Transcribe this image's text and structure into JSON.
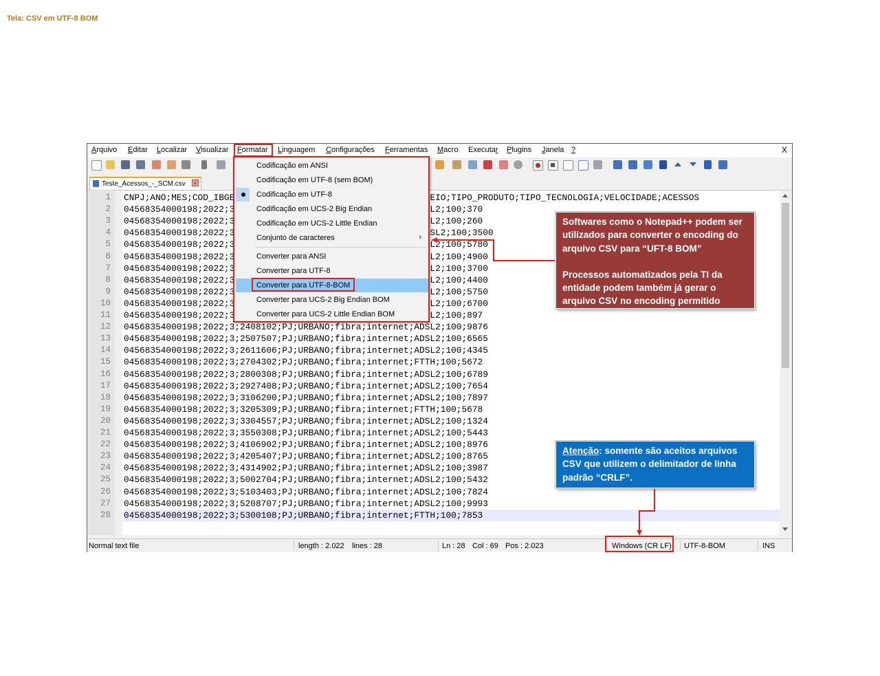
{
  "page": {
    "caption": "Tela: CSV em UTF-8 BOM"
  },
  "menubar": {
    "items": [
      {
        "id": "arquivo",
        "pre": "",
        "u": "A",
        "post": "rquivo"
      },
      {
        "id": "editar",
        "pre": "",
        "u": "E",
        "post": "ditar"
      },
      {
        "id": "localizar",
        "pre": "",
        "u": "L",
        "post": "ocalizar"
      },
      {
        "id": "visualizar",
        "pre": "",
        "u": "V",
        "post": "isualizar"
      },
      {
        "id": "formatar",
        "pre": "",
        "u": "F",
        "post": "ormatar"
      },
      {
        "id": "linguagem",
        "pre": "",
        "u": "L",
        "post": "inguagem"
      },
      {
        "id": "configuracoes",
        "pre": "",
        "u": "C",
        "post": "onfigurações"
      },
      {
        "id": "ferramentas",
        "pre": "",
        "u": "F",
        "post": "erramentas"
      },
      {
        "id": "macro",
        "pre": "",
        "u": "M",
        "post": "acro"
      },
      {
        "id": "executar",
        "pre": "Executa",
        "u": "r",
        "post": ""
      },
      {
        "id": "plugins",
        "pre": "",
        "u": "P",
        "post": "lugins"
      },
      {
        "id": "janela",
        "pre": "",
        "u": "J",
        "post": "anela"
      },
      {
        "id": "help",
        "pre": "",
        "u": "?",
        "post": ""
      }
    ],
    "close": "X"
  },
  "tab": {
    "label": "Teste_Acessos_-_SCM.csv",
    "close": "×"
  },
  "format_menu": {
    "items": [
      {
        "label": "Codificação em ANSI"
      },
      {
        "label": "Codificação em UTF-8 (sem BOM)"
      },
      {
        "label": "Codificação em UTF-8",
        "checked": true
      },
      {
        "label": "Codificação em UCS-2 Big Endian"
      },
      {
        "label": "Codificação em UCS-2 Little Endian"
      },
      {
        "label": "Conjunto de caracteres",
        "submenu_arrow": "›"
      },
      {
        "label": "Converter para ANSI"
      },
      {
        "label": "Converter para UTF-8"
      },
      {
        "label": "Converter para UTF-8-BOM",
        "highlighted": true
      },
      {
        "label": "Converter para UCS-2 Big Endian BOM"
      },
      {
        "label": "Converter para UCS-2 Little Endian BOM"
      }
    ]
  },
  "editor": {
    "line_numbers": [
      "1",
      "2",
      "3",
      "4",
      "5",
      "6",
      "7",
      "8",
      "9",
      "10",
      "11",
      "12",
      "13",
      "14",
      "15",
      "16",
      "17",
      "18",
      "19",
      "20",
      "21",
      "22",
      "23",
      "24",
      "25",
      "26",
      "27",
      "28"
    ],
    "lines": [
      "CNPJ;ANO;MES;COD_IBGE;TIPO_CLIENTE;TIPO_ATENDIMENTO;TIPO_MEIO;TIPO_PRODUTO;TIPO_TECNOLOGIA;VELOCIDADE;ACESSOS",
      "04568354000198;2022;3;1100015;PJ;URBANO;fibra;internet;ADSL2;100;370",
      "04568354000198;2022;3;1200401;PJ;URBANO;fibra;internet;ADSL2;100;260",
      "04568354000198;2022;3;1302603;PJ;URBANO;fibra;internet;ADSSL2;100;3500",
      "04568354000198;2022;3;1400100;PJ;URBANO;fibra;internet;ADSL2;100;5780",
      "04568354000198;2022;3;1501402;PJ;URBANO;fibra;internet;ADSL2;100;4900",
      "04568354000198;2022;3;1600303;PJ;URBANO;fibra;internet;ADSL2;100;3700",
      "04568354000198;2022;3;1721000;PJ;URBANO;fibra;internet;ADSL2;100;4400",
      "04568354000198;2022;3;2111300;PJ;URBANO;fibra;internet;ADSL2;100;5750",
      "04568354000198;2022;3;2211001;PJ;URBANO;fibra;internet;ADSL2;100;6700",
      "04568354000198;2022;3;2304400;PJ;URBANO;fibra;internet;ADSL2;100;897",
      "04568354000198;2022;3;2408102;PJ;URBANO;fibra;internet;ADSL2;100;9876",
      "04568354000198;2022;3;2507507;PJ;URBANO;fibra;internet;ADSL2;100;6565",
      "04568354000198;2022;3;2611606;PJ;URBANO;fibra;internet;ADSL2;100;4345",
      "04568354000198;2022;3;2704302;PJ;URBANO;fibra;internet;FTTH;100;5672",
      "04568354000198;2022;3;2800308;PJ;URBANO;fibra;internet;ADSL2;100;6789",
      "04568354000198;2022;3;2927408;PJ;URBANO;fibra;internet;ADSL2;100;7654",
      "04568354000198;2022;3;3106200;PJ;URBANO;fibra;internet;ADSL2;100;7897",
      "04568354000198;2022;3;3205309;PJ;URBANO;fibra;internet;FTTH;100;5678",
      "04568354000198;2022;3;3304557;PJ;URBANO;fibra;internet;ADSL2;100;1324",
      "04568354000198;2022;3;3550308;PJ;URBANO;fibra;internet;ADSL2;100;5443",
      "04568354000198;2022;3;4106902;PJ;URBANO;fibra;internet;ADSL2;100;8976",
      "04568354000198;2022;3;4205407;PJ;URBANO;fibra;internet;ADSL2;100;8765",
      "04568354000198;2022;3;4314902;PJ;URBANO;fibra;internet;ADSL2;100;3987",
      "04568354000198;2022;3;5002704;PJ;URBANO;fibra;internet;ADSL2;100;5432",
      "04568354000198;2022;3;5103403;PJ;URBANO;fibra;internet;ADSL2;100;7824",
      "04568354000198;2022;3;5208707;PJ;URBANO;fibra;internet;ADSL2;100;9993",
      "04568354000198;2022;3;5300108;PJ;URBANO;fibra;internet;FTTH;100;7853"
    ]
  },
  "statusbar": {
    "file_type": "Normal text file",
    "length": "length : 2.022",
    "lines": "lines : 28",
    "ln": "Ln : 28",
    "col": "Col : 69",
    "pos": "Pos : 2.023",
    "eol": "Windows (CR LF)",
    "encoding": "UTF-8-BOM",
    "mode": "INS"
  },
  "callouts": {
    "red": {
      "line1": "Softwares como o Notepad++ podem ser utilizados para converter o encoding do arquivo CSV para “UFT-8 BOM”",
      "line2": "Processos automatizados pela TI da entidade podem também já gerar o arquivo CSV no encoding permitido"
    },
    "blue": {
      "attention": "Atenção",
      "rest": ": somente são aceitos arquivos CSV que utilizem o delimitador de linha padrão “CRLF”."
    }
  },
  "colors": {
    "highlight_red": "#e0201c",
    "callout_red": "#983b38",
    "callout_blue": "#0b70c4",
    "menu_highlight": "#91c9f7",
    "caption": "#c0761a"
  }
}
